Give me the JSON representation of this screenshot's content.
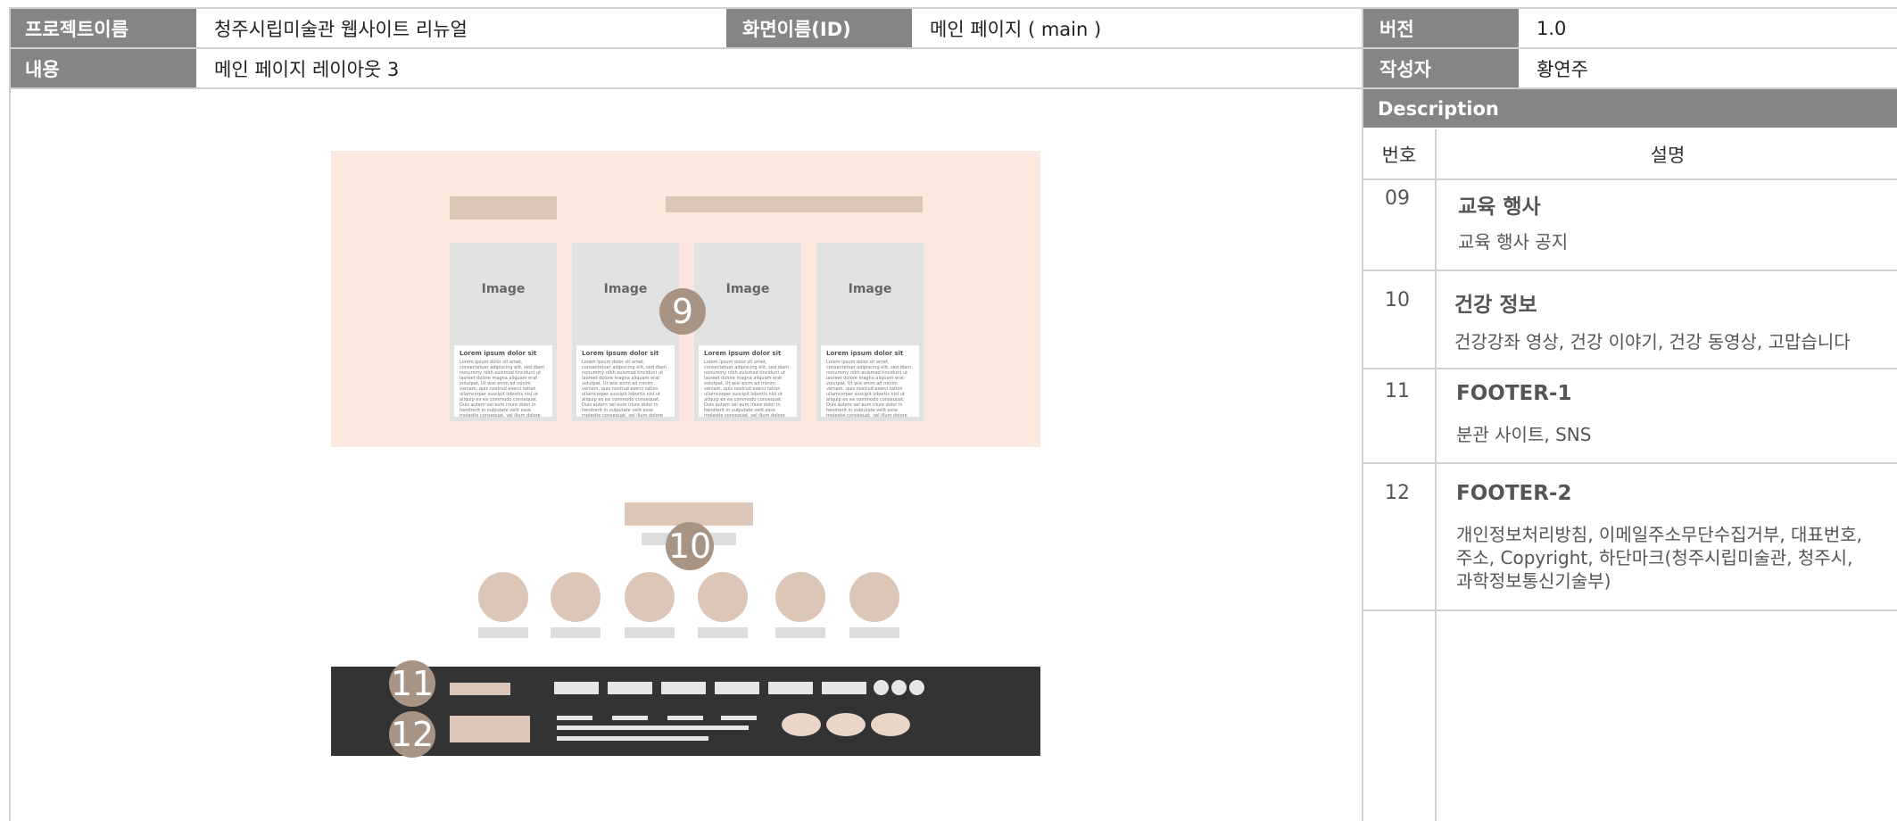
{
  "header": {
    "project_label": "프로젝트이름",
    "project_value": "청주시립미술관 웹사이트 리뉴얼",
    "screen_label": "화면이름(ID)",
    "screen_value": "메인 페이지 ( main )",
    "version_label": "버전",
    "version_value": "1.0",
    "content_label": "내용",
    "content_value": "메인 페이지 레이아웃 3",
    "author_label": "작성자",
    "author_value": "황연주"
  },
  "description": {
    "title": "Description",
    "col_number": "번호",
    "col_desc": "설명",
    "items": [
      {
        "num": "09",
        "title": "교육 행사",
        "text": "교육 행사 공지"
      },
      {
        "num": "10",
        "title": "건강 정보",
        "text": "건강강좌 영상, 건강 이야기, 건강 동영상, 고맙습니다"
      },
      {
        "num": "11",
        "title": "FOOTER-1",
        "text": "분관 사이트, SNS"
      },
      {
        "num": "12",
        "title": "FOOTER-2",
        "text": "개인정보처리방침, 이메일주소무단수집거부, 대표번호, 주소, Copyright, 하단마크(청주시립미술관, 청주시, 과학정보통신기술부)"
      }
    ]
  },
  "wireframe": {
    "cards": [
      {
        "image": "Image",
        "title": "Lorem ipsum dolor sit",
        "body": "Lorem ipsum dolor sit amet, consectetuer adipiscing elit, sed diam nonummy nibh euismod tincidunt ut laoreet dolore magna aliquam erat volutpat. Ut wisi enim ad minim veniam, quis nostrud exerci tation ullamcorper suscipit lobortis nisl ut aliquip ex ea commodo consequat. Duis autem vel eum iriure dolor in hendrerit in vulputate velit esse molestie consequat, vel illum dolore eu feugiat nulla facilisis at"
      },
      {
        "image": "Image",
        "title": "Lorem ipsum dolor sit",
        "body": "Lorem ipsum dolor sit amet, consectetuer adipiscing elit, sed diam nonummy nibh euismod tincidunt ut laoreet dolore magna aliquam erat volutpat. Ut wisi enim ad minim veniam, quis nostrud exerci tation ullamcorper suscipit lobortis nisl ut aliquip ex ea commodo consequat. Duis autem vel eum iriure dolor in hendrerit in vulputate velit esse molestie consequat, vel illum dolore eu feugiat nulla facilisis at"
      },
      {
        "image": "Image",
        "title": "Lorem ipsum dolor sit",
        "body": "Lorem ipsum dolor sit amet, consectetuer adipiscing elit, sed diam nonummy nibh euismod tincidunt ut laoreet dolore magna aliquam erat volutpat. Ut wisi enim ad minim veniam, quis nostrud exerci tation ullamcorper suscipit lobortis nisl ut aliquip ex ea commodo consequat. Duis autem vel eum iriure dolor in hendrerit in vulputate velit esse molestie consequat, vel illum dolore eu feugiat nulla facilisis at"
      },
      {
        "image": "Image",
        "title": "Lorem ipsum dolor sit",
        "body": "Lorem ipsum dolor sit amet, consectetuer adipiscing elit, sed diam nonummy nibh euismod tincidunt ut laoreet dolore magna aliquam erat volutpat. Ut wisi enim ad minim veniam, quis nostrud exerci tation ullamcorper suscipit lobortis nisl ut aliquip ex ea commodo consequat. Duis autem vel eum iriure dolor in hendrerit in vulputate velit esse molestie consequat, vel illum dolore eu feugiat nulla facilisis at"
      }
    ],
    "badges": [
      "9",
      "10",
      "11",
      "12"
    ]
  }
}
